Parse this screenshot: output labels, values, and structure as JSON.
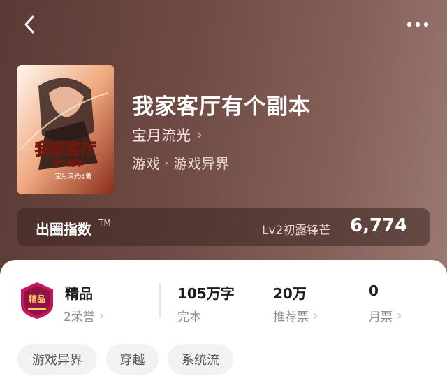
{
  "book": {
    "title": "我家客厅有个副本",
    "author": "宝月流光",
    "genre": "游戏 · 游戏异界",
    "cover": {
      "title_main": "我家客厅",
      "title_sub": "有个副本",
      "author_tag": "宝月流光◎著"
    }
  },
  "index": {
    "label": "出圈指数",
    "tm": "TM",
    "level": "Lv2初露锋芒",
    "value": "6,774"
  },
  "stats": {
    "quality": {
      "title": "精品",
      "sub": "2荣誉"
    },
    "words": {
      "title": "105万字",
      "sub": "完本"
    },
    "recommend": {
      "title": "20万",
      "sub": "推荐票"
    },
    "monthly": {
      "title": "0",
      "sub": "月票"
    }
  },
  "badge_text": "精品",
  "tags": [
    "游戏异界",
    "穿越",
    "系统流"
  ],
  "colors": {
    "hero_bg": "#6e4a44",
    "badge": "#c2185b"
  }
}
